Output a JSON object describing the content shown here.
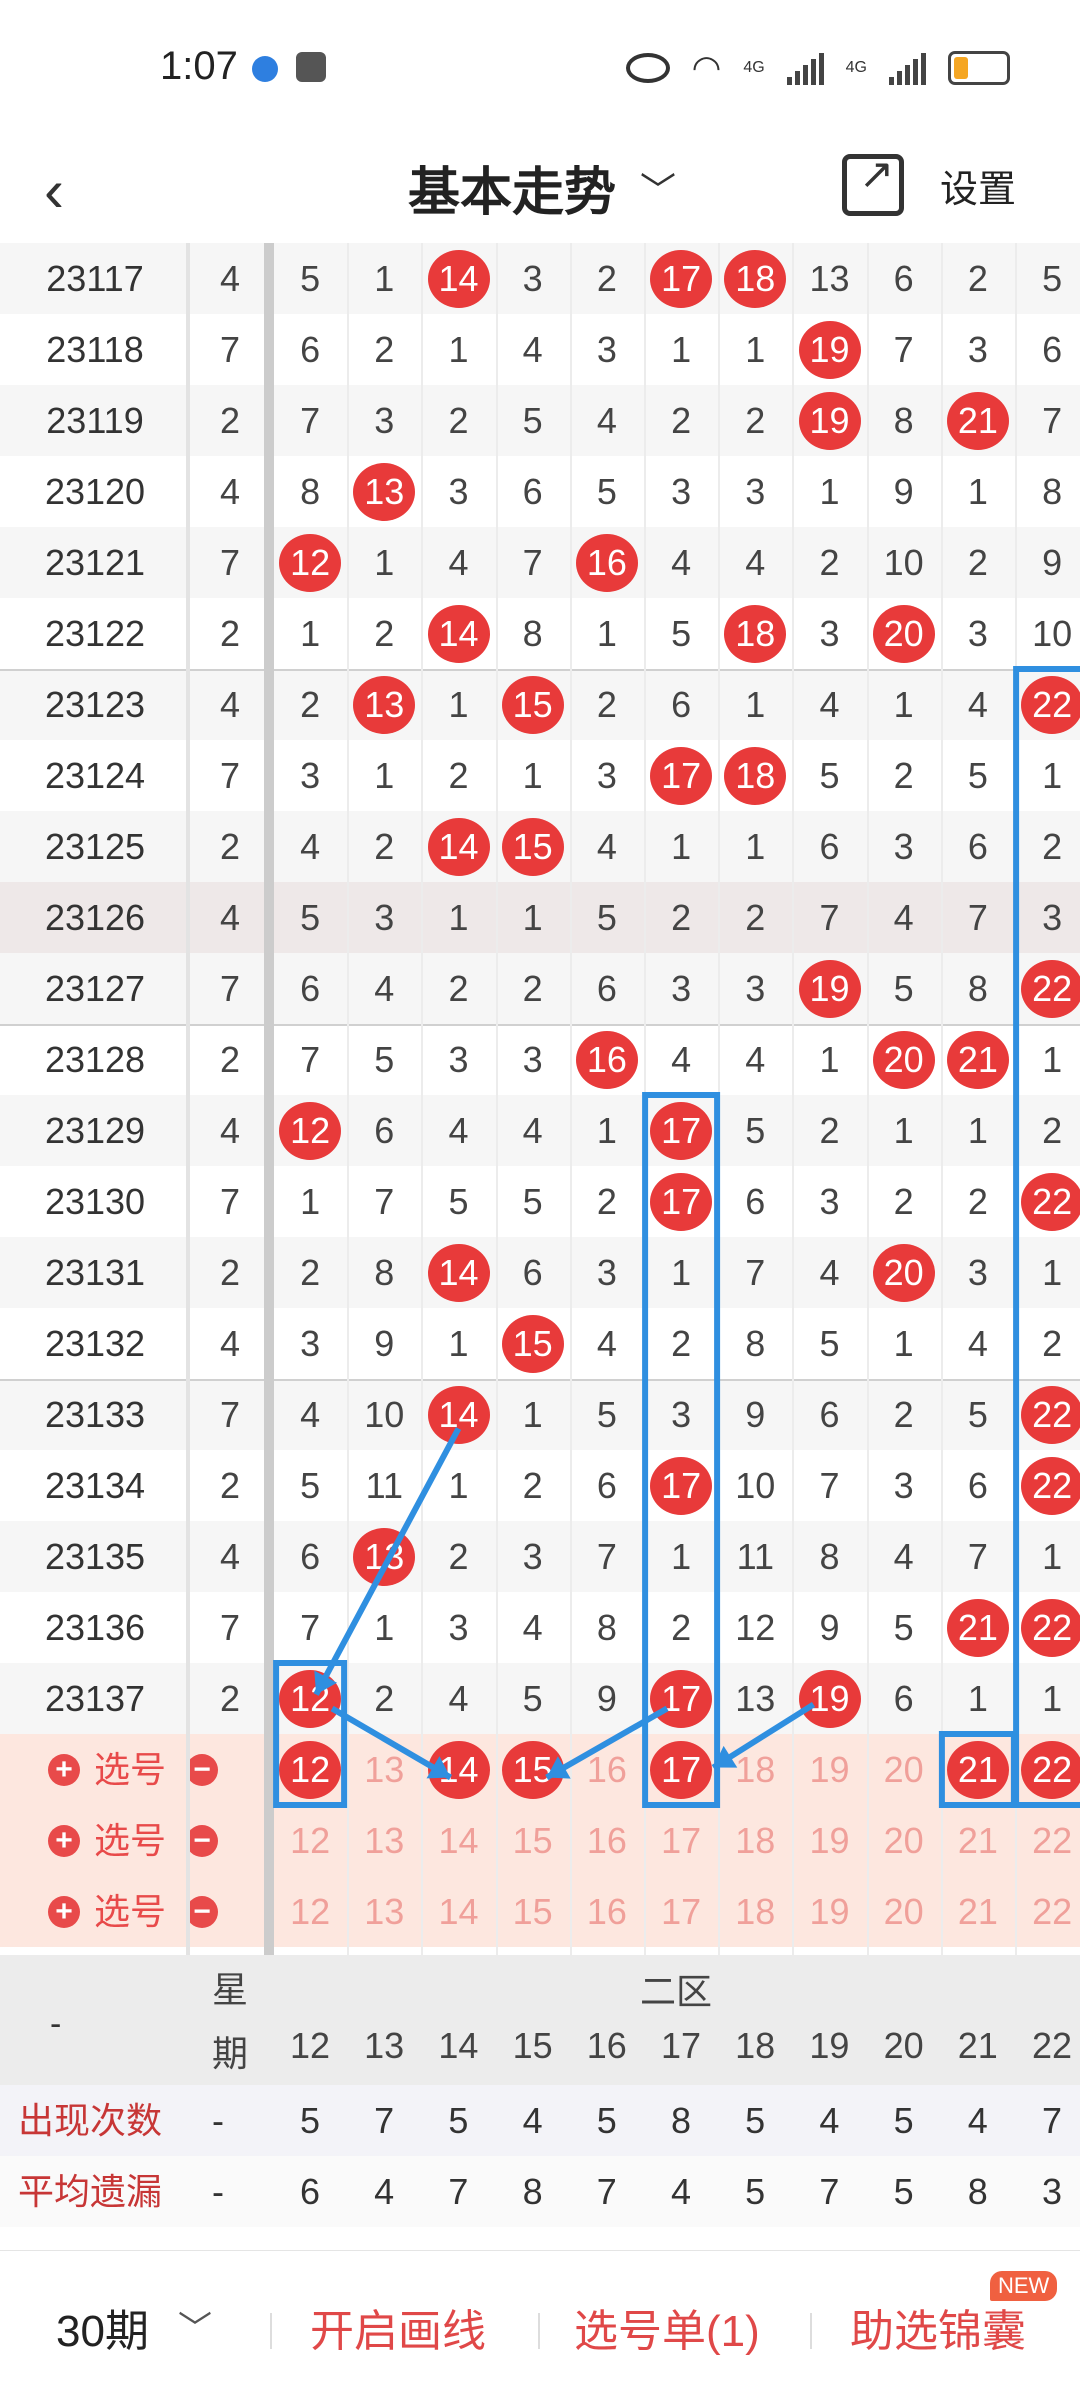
{
  "status_bar": {
    "time": "1:07",
    "network_1": "4G",
    "network_2": "4G"
  },
  "header": {
    "title": "基本走势",
    "settings_label": "设置"
  },
  "columns": [
    "12",
    "13",
    "14",
    "15",
    "16",
    "17",
    "18",
    "19",
    "20",
    "21",
    "22"
  ],
  "rows": [
    {
      "id": "23117",
      "wk": "4",
      "vals": [
        "5",
        "1",
        "14",
        "3",
        "2",
        "17",
        "18",
        "13",
        "6",
        "2",
        "5"
      ],
      "hits": [
        2,
        5,
        6
      ]
    },
    {
      "id": "23118",
      "wk": "7",
      "vals": [
        "6",
        "2",
        "1",
        "4",
        "3",
        "1",
        "1",
        "19",
        "7",
        "3",
        "6"
      ],
      "hits": [
        7
      ]
    },
    {
      "id": "23119",
      "wk": "2",
      "vals": [
        "7",
        "3",
        "2",
        "5",
        "4",
        "2",
        "2",
        "19",
        "8",
        "21",
        "7"
      ],
      "hits": [
        7,
        9
      ]
    },
    {
      "id": "23120",
      "wk": "4",
      "vals": [
        "8",
        "13",
        "3",
        "6",
        "5",
        "3",
        "3",
        "1",
        "9",
        "1",
        "8"
      ],
      "hits": [
        1
      ]
    },
    {
      "id": "23121",
      "wk": "7",
      "vals": [
        "12",
        "1",
        "4",
        "7",
        "16",
        "4",
        "4",
        "2",
        "10",
        "2",
        "9"
      ],
      "hits": [
        0,
        4
      ]
    },
    {
      "id": "23122",
      "wk": "2",
      "vals": [
        "1",
        "2",
        "14",
        "8",
        "1",
        "5",
        "18",
        "3",
        "20",
        "3",
        "10"
      ],
      "hits": [
        2,
        6,
        8
      ]
    },
    {
      "id": "23123",
      "wk": "4",
      "vals": [
        "2",
        "13",
        "1",
        "15",
        "2",
        "6",
        "1",
        "4",
        "1",
        "4",
        "22"
      ],
      "hits": [
        1,
        3,
        10
      ]
    },
    {
      "id": "23124",
      "wk": "7",
      "vals": [
        "3",
        "1",
        "2",
        "1",
        "3",
        "17",
        "18",
        "5",
        "2",
        "5",
        "1"
      ],
      "hits": [
        5,
        6
      ]
    },
    {
      "id": "23125",
      "wk": "2",
      "vals": [
        "4",
        "2",
        "14",
        "15",
        "4",
        "1",
        "1",
        "6",
        "3",
        "6",
        "2"
      ],
      "hits": [
        2,
        3
      ]
    },
    {
      "id": "23126",
      "wk": "4",
      "vals": [
        "5",
        "3",
        "1",
        "1",
        "5",
        "2",
        "2",
        "7",
        "4",
        "7",
        "3"
      ],
      "hits": []
    },
    {
      "id": "23127",
      "wk": "7",
      "vals": [
        "6",
        "4",
        "2",
        "2",
        "6",
        "3",
        "3",
        "19",
        "5",
        "8",
        "22"
      ],
      "hits": [
        7,
        10
      ]
    },
    {
      "id": "23128",
      "wk": "2",
      "vals": [
        "7",
        "5",
        "3",
        "3",
        "16",
        "4",
        "4",
        "1",
        "20",
        "21",
        "1"
      ],
      "hits": [
        4,
        8,
        9
      ]
    },
    {
      "id": "23129",
      "wk": "4",
      "vals": [
        "12",
        "6",
        "4",
        "4",
        "1",
        "17",
        "5",
        "2",
        "1",
        "1",
        "2"
      ],
      "hits": [
        0,
        5
      ]
    },
    {
      "id": "23130",
      "wk": "7",
      "vals": [
        "1",
        "7",
        "5",
        "5",
        "2",
        "17",
        "6",
        "3",
        "2",
        "2",
        "22"
      ],
      "hits": [
        5,
        10
      ]
    },
    {
      "id": "23131",
      "wk": "2",
      "vals": [
        "2",
        "8",
        "14",
        "6",
        "3",
        "1",
        "7",
        "4",
        "20",
        "3",
        "1"
      ],
      "hits": [
        2,
        8
      ]
    },
    {
      "id": "23132",
      "wk": "4",
      "vals": [
        "3",
        "9",
        "1",
        "15",
        "4",
        "2",
        "8",
        "5",
        "1",
        "4",
        "2"
      ],
      "hits": [
        3
      ]
    },
    {
      "id": "23133",
      "wk": "7",
      "vals": [
        "4",
        "10",
        "14",
        "1",
        "5",
        "3",
        "9",
        "6",
        "2",
        "5",
        "22"
      ],
      "hits": [
        2,
        10
      ]
    },
    {
      "id": "23134",
      "wk": "2",
      "vals": [
        "5",
        "11",
        "1",
        "2",
        "6",
        "17",
        "10",
        "7",
        "3",
        "6",
        "22"
      ],
      "hits": [
        5,
        10
      ]
    },
    {
      "id": "23135",
      "wk": "4",
      "vals": [
        "6",
        "13",
        "2",
        "3",
        "7",
        "1",
        "11",
        "8",
        "4",
        "7",
        "1"
      ],
      "hits": [
        1
      ]
    },
    {
      "id": "23136",
      "wk": "7",
      "vals": [
        "7",
        "1",
        "3",
        "4",
        "8",
        "2",
        "12",
        "9",
        "5",
        "21",
        "22"
      ],
      "hits": [
        9,
        10
      ]
    },
    {
      "id": "23137",
      "wk": "2",
      "vals": [
        "12",
        "2",
        "4",
        "5",
        "9",
        "17",
        "13",
        "19",
        "6",
        "1",
        "1"
      ],
      "hits": [
        0,
        5,
        7
      ]
    }
  ],
  "pick_rows": [
    {
      "label": "选号",
      "vals": [
        "12",
        "13",
        "14",
        "15",
        "16",
        "17",
        "18",
        "19",
        "20",
        "21",
        "22"
      ],
      "selected": [
        0,
        2,
        3,
        5,
        9,
        10
      ]
    },
    {
      "label": "选号",
      "vals": [
        "12",
        "13",
        "14",
        "15",
        "16",
        "17",
        "18",
        "19",
        "20",
        "21",
        "22"
      ],
      "selected": []
    },
    {
      "label": "选号",
      "vals": [
        "12",
        "13",
        "14",
        "15",
        "16",
        "17",
        "18",
        "19",
        "20",
        "21",
        "22"
      ],
      "selected": []
    }
  ],
  "footer_header": {
    "corner": "-",
    "week_top": "星",
    "week_bottom": "期",
    "zone": "二区"
  },
  "stats": [
    {
      "label": "出现次数",
      "dash": "-",
      "vals": [
        "5",
        "7",
        "5",
        "4",
        "5",
        "8",
        "5",
        "4",
        "5",
        "4",
        "7"
      ]
    },
    {
      "label": "平均遗漏",
      "dash": "-",
      "vals": [
        "6",
        "4",
        "7",
        "8",
        "7",
        "4",
        "5",
        "7",
        "5",
        "8",
        "3"
      ]
    }
  ],
  "bottom_bar": {
    "period": "30期",
    "draw_line": "开启画线",
    "pick_list": "选号单(1)",
    "assist": "助选锦囊",
    "new_badge": "NEW"
  },
  "colors": {
    "ball": "#e83a3a",
    "annotation": "#2f8fe0",
    "accent": "#e04848"
  }
}
